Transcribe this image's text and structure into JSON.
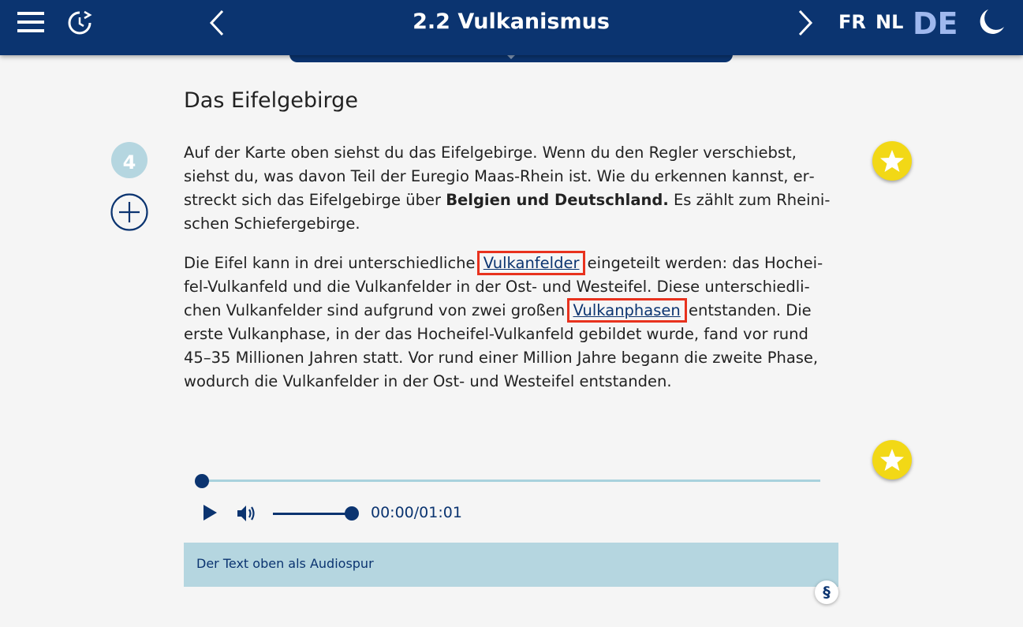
{
  "header": {
    "title": "2.2 Vulkanismus",
    "languages": [
      "FR",
      "NL",
      "DE"
    ],
    "active_language": "DE",
    "icons": [
      "menu-icon",
      "history-icon",
      "chevron-left-icon",
      "chevron-right-icon",
      "moon-icon"
    ]
  },
  "section": {
    "title": "Das Eifelgebirge",
    "number": "4"
  },
  "paragraph1": {
    "text1": "Auf der Karte oben siehst du das Eifelgebirge. Wenn du den Regler verschiebst, siehst du, was davon Teil der Euregio Maas-Rhein ist. Wie du erkennen kannst, er­streckt sich das Eifelgebirge über ",
    "bold": "Belgien und Deutschland.",
    "text2": " Es zählt zum Rheini­schen Schiefergebirge."
  },
  "paragraph2": {
    "text1": "Die Eifel kann in drei unterschiedliche ",
    "link1": "Vulkanfelder",
    "text2": " eingeteilt werden: das Hochei­fel-Vulkanfeld und die Vulkanfelder in der Ost- und Westeifel. Diese unterschiedli­chen Vulkanfelder sind aufgrund von zwei großen ",
    "link2": "Vulkanphasen",
    "text3": " entstanden. Die erste Vulkanphase, in der das Hocheifel-Vulkanfeld gebildet wurde, fand vor rund 45–35 Millionen Jahren statt. Vor rund einer Million Jahre begann die zweite Phase, wodurch die Vulkanfelder in der Ost- und Westeifel entstanden."
  },
  "audio": {
    "time": "00:00/01:01",
    "progress": 0,
    "volume": 1.0,
    "caption": "Der Text oben als Audiospur"
  },
  "paragraph_symbol": "§",
  "colors": {
    "header_bg": "#0b3470",
    "accent_light": "#b5d6e0",
    "star": "#f2d816",
    "highlight": "#e8321e"
  }
}
